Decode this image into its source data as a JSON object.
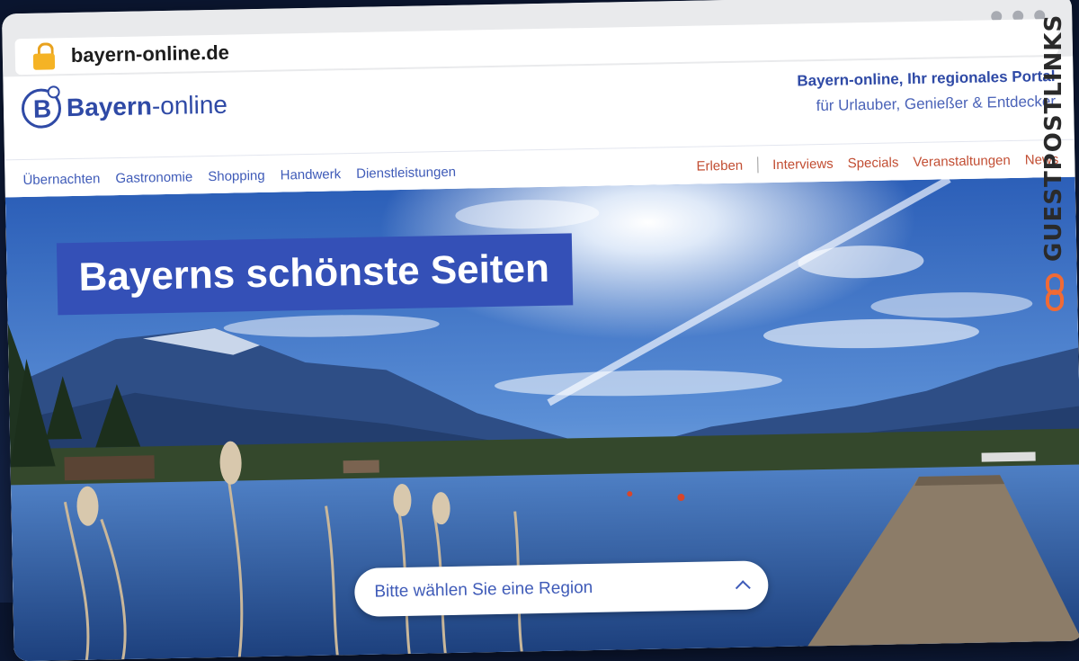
{
  "browser": {
    "url": "bayern-online.de"
  },
  "header": {
    "logo_letter": "B",
    "logo_bold": "Bayern",
    "logo_rest": "-online",
    "tagline_1": "Bayern-online, Ihr regionales Portal",
    "tagline_2": "für Urlauber, Genießer & Entdecker"
  },
  "nav": {
    "left": [
      "Übernachten",
      "Gastronomie",
      "Shopping",
      "Handwerk",
      "Dienstleistungen"
    ],
    "right": [
      "Erleben",
      "Interviews",
      "Specials",
      "Veranstaltungen",
      "News"
    ]
  },
  "hero": {
    "title": "Bayerns schönste Seiten",
    "region_placeholder": "Bitte wählen Sie eine Region"
  },
  "watermark": {
    "text": "GUESTPOSTLINKS"
  },
  "colors": {
    "brand_blue": "#3450b7",
    "nav_red": "#c24e33",
    "lock": "#f5b325"
  }
}
